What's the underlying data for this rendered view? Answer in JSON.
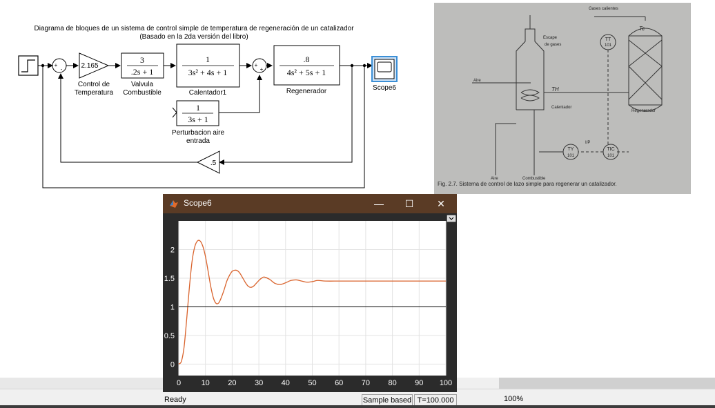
{
  "diagram": {
    "title_line1": "Diagrama de bloques de un sistema de control simple de temperatura de regeneración de un catalizador",
    "title_line2": "(Basado en la 2da versión del libro)",
    "gain_value": "2.165",
    "gain_label_1": "Control de",
    "gain_label_2": "Temperatura",
    "valve_num": "3",
    "valve_den": ".2s + 1",
    "valve_label_1": "Valvula",
    "valve_label_2": "Combustible",
    "heater_num": "1",
    "heater_den": "3s² + 4s + 1",
    "heater_label": "Calentador1",
    "regen_num": ".8",
    "regen_den": "4s² + 5s + 1",
    "regen_label": "Regenerador",
    "dist_num": "1",
    "dist_den": "3s + 1",
    "dist_label_1": "Perturbacion aire",
    "dist_label_2": "entrada",
    "feedback_gain": ".5",
    "scope_label": "Scope6",
    "sum1_signs": [
      "+",
      "-"
    ],
    "sum2_signs": [
      "+",
      "+"
    ]
  },
  "photo": {
    "caption": "Fig. 2.7. Sistema de control de lazo simple para regenerar un catalizador.",
    "labels": {
      "gases_calientes": "Gases calientes",
      "escape": "Escape",
      "de_gases": "de gases",
      "tt": "TT",
      "tt_num": "101",
      "tc": "Tc",
      "aire_top": "Aire",
      "th": "TH",
      "calentador": "Calentador",
      "regenerador": "Regenerador",
      "ty": "TY",
      "ty_num": "101",
      "tic": "TIC",
      "tic_num": "101",
      "aire_bottom": "Aire",
      "combustible": "Combustible",
      "ip": "I/P"
    }
  },
  "scope_window": {
    "title": "Scope6",
    "minimize_glyph": "—",
    "maximize_glyph": "☐",
    "close_glyph": "✕",
    "status_ready": "Ready",
    "status_mode": "Sample based",
    "status_time": "T=100.000"
  },
  "chart_data": {
    "type": "line",
    "title": "",
    "xlabel": "",
    "ylabel": "",
    "xlim": [
      0,
      100
    ],
    "ylim": [
      -0.2,
      2.5
    ],
    "x_ticks": [
      "0",
      "10",
      "20",
      "30",
      "40",
      "50",
      "60",
      "70",
      "80",
      "90",
      "100"
    ],
    "y_ticks": [
      "0",
      "0.5",
      "1",
      "1.5",
      "2"
    ],
    "grid": true,
    "background": "#ffffff",
    "series": [
      {
        "color": "#d9622b",
        "x": [
          0,
          1,
          2,
          3,
          4,
          5,
          6,
          7,
          8,
          9,
          10,
          11,
          12,
          13,
          14,
          15,
          16,
          17,
          18,
          19,
          20,
          21,
          22,
          23,
          24,
          25,
          26,
          27,
          28,
          29,
          30,
          31,
          32,
          34,
          36,
          38,
          40,
          42,
          44,
          46,
          48,
          50,
          52,
          55,
          60,
          65,
          70,
          75,
          80,
          90,
          100
        ],
        "y": [
          0,
          0.05,
          0.3,
          0.8,
          1.35,
          1.8,
          2.05,
          2.15,
          2.15,
          2.06,
          1.88,
          1.62,
          1.35,
          1.15,
          1.06,
          1.07,
          1.17,
          1.3,
          1.45,
          1.55,
          1.62,
          1.64,
          1.63,
          1.58,
          1.5,
          1.42,
          1.36,
          1.34,
          1.36,
          1.41,
          1.46,
          1.5,
          1.52,
          1.48,
          1.41,
          1.39,
          1.42,
          1.46,
          1.47,
          1.45,
          1.43,
          1.44,
          1.46,
          1.45,
          1.45,
          1.45,
          1.45,
          1.45,
          1.45,
          1.45,
          1.45
        ]
      },
      {
        "color": "#000000",
        "x": [
          0,
          100
        ],
        "y": [
          1,
          1
        ]
      }
    ]
  },
  "bottom": {
    "zoom": "100%"
  }
}
